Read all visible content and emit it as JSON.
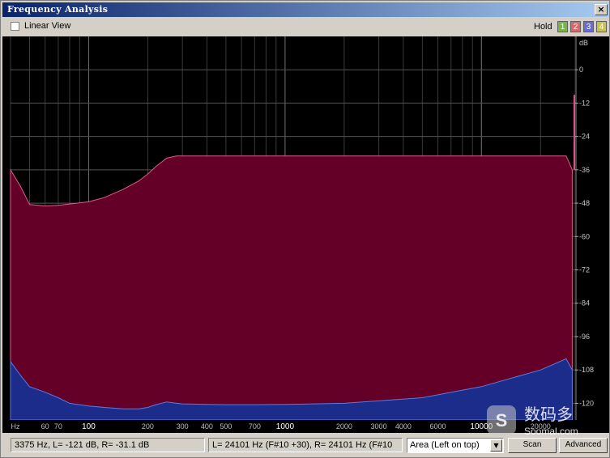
{
  "window": {
    "title": "Frequency Analysis",
    "close_glyph": "×"
  },
  "toolbar": {
    "linear_view_label": "Linear View",
    "linear_view_checked": false,
    "hold_label": "Hold",
    "hold_buttons": [
      {
        "label": "1",
        "color": "#7ab34a"
      },
      {
        "label": "2",
        "color": "#d66a6a"
      },
      {
        "label": "3",
        "color": "#6a6ad6"
      },
      {
        "label": "4",
        "color": "#c8c050"
      }
    ]
  },
  "chart_data": {
    "type": "area",
    "xlabel": "Hz",
    "ylabel": "dB",
    "x_scale": "log",
    "xlim": [
      40,
      30000
    ],
    "ylim": [
      -126,
      12
    ],
    "grid": true,
    "x_ticks": [
      "Hz",
      "60",
      "70",
      "100",
      "200",
      "300",
      "400",
      "500",
      "700",
      "1000",
      "2000",
      "3000",
      "4000",
      "6000",
      "10000",
      "20000"
    ],
    "x_tick_values": [
      null,
      60,
      70,
      100,
      200,
      300,
      400,
      500,
      700,
      1000,
      2000,
      3000,
      4000,
      6000,
      10000,
      20000
    ],
    "y_ticks": [
      "0",
      "-12",
      "-24",
      "-36",
      "-48",
      "-60",
      "-72",
      "-84",
      "-96",
      "-108",
      "-120"
    ],
    "y_tick_values": [
      0,
      -12,
      -24,
      -36,
      -48,
      -60,
      -72,
      -84,
      -96,
      -108,
      -120
    ],
    "series": [
      {
        "fill": "#640028",
        "stroke": "#e05a8a",
        "x": [
          40,
          45,
          50,
          60,
          70,
          80,
          100,
          120,
          150,
          180,
          200,
          220,
          250,
          280,
          300,
          500,
          1000,
          2000,
          5000,
          10000,
          20000,
          27000,
          29000
        ],
        "y": [
          -36,
          -42,
          -48.5,
          -49,
          -48.8,
          -48.3,
          -47.5,
          -46,
          -43,
          -40,
          -37.5,
          -34.8,
          -31.8,
          -31,
          -31,
          -31,
          -31,
          -31,
          -31,
          -31,
          -31,
          -31,
          -36
        ]
      },
      {
        "fill": "#1c2c8a",
        "stroke": "#5a7ae0",
        "x": [
          40,
          45,
          50,
          60,
          70,
          80,
          100,
          120,
          150,
          180,
          200,
          220,
          250,
          280,
          300,
          400,
          500,
          700,
          1000,
          2000,
          5000,
          10000,
          20000,
          27000,
          29000
        ],
        "y": [
          -105,
          -110,
          -114,
          -116,
          -118,
          -120,
          -121,
          -121.5,
          -122,
          -122,
          -121.5,
          -120.5,
          -119.5,
          -120,
          -120.2,
          -120.4,
          -120.5,
          -120.5,
          -120.4,
          -120,
          -118,
          -114,
          -108,
          -104,
          -108
        ]
      }
    ]
  },
  "status": {
    "left_readout": "3375 Hz, L=  -121 dB, R= -31.1 dB",
    "center_readout": "L=  24101 Hz (F#10 +30), R=  24101 Hz (F#10",
    "display_mode": "Area (Left on top)",
    "scan_label": "Scan",
    "advanced_label": "Advanced"
  },
  "watermark": {
    "text": "数码多",
    "site": "Soomal.com",
    "logo_letter": "S"
  }
}
